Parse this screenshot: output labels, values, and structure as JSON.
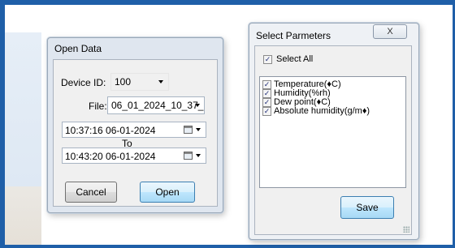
{
  "open_dialog": {
    "title": "Open Data",
    "device_label": "Device ID:",
    "device_value": "100",
    "file_label": "File:",
    "file_value": "06_01_2024_10_37_",
    "from_datetime": "10:37:16 06-01-2024",
    "to_label": "To",
    "to_datetime": "10:43:20 06-01-2024",
    "cancel_label": "Cancel",
    "open_label": "Open"
  },
  "select_dialog": {
    "title": "Select Parmeters",
    "close_label": "X",
    "select_all_label": "Select All",
    "select_all_checked": true,
    "parameters": [
      {
        "label": "Temperature(♦C)",
        "checked": true
      },
      {
        "label": "Humidity(%rh)",
        "checked": true
      },
      {
        "label": "Dew point(♦C)",
        "checked": true
      },
      {
        "label": "Absolute humidity(g/m♦)",
        "checked": true
      }
    ],
    "save_label": "Save"
  },
  "colors": {
    "frame": "#1f5fa8",
    "dialog_bg": "#dfe6ef",
    "focus_border": "#3c7fb1"
  }
}
